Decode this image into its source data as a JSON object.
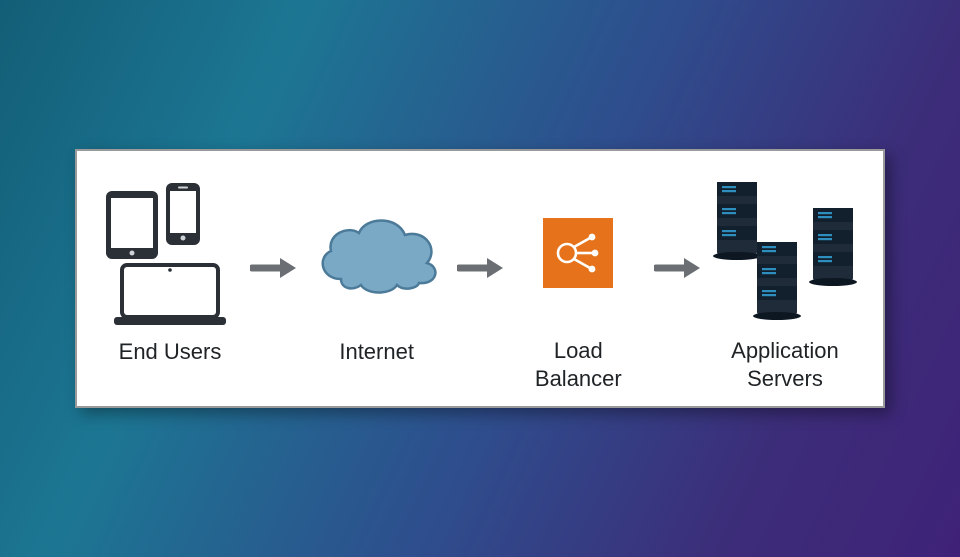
{
  "stages": {
    "end_users": {
      "label": "End Users"
    },
    "internet": {
      "label": "Internet"
    },
    "load_balancer": {
      "label": "Load Balancer"
    },
    "app_servers": {
      "label": "Application\nServers"
    }
  },
  "icons": {
    "devices": "devices-icon",
    "cloud": "cloud-icon",
    "load_balancer": "load-balancer-icon",
    "servers": "servers-icon",
    "arrow": "arrow-right-icon"
  },
  "colors": {
    "panel_border": "#9a9a9a",
    "arrow": "#6b6f73",
    "cloud_fill": "#7aa9c6",
    "cloud_stroke": "#4c7a99",
    "lb_bg": "#e6731b",
    "lb_fg": "#ffffff",
    "server_body": "#1f2b38",
    "server_accent": "#2e8fbf",
    "device_stroke": "#2b3036",
    "label_text": "#1f2326"
  }
}
